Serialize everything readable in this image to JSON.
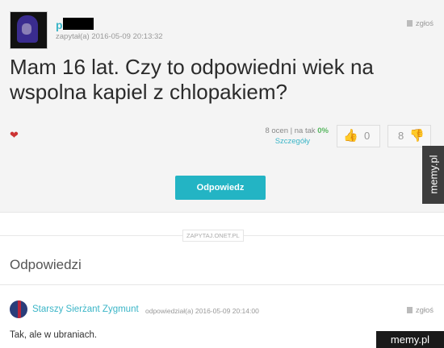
{
  "question": {
    "username": "p       ta",
    "asked_label": "zapytał(a) 2016-05-09 20:13:32",
    "report_label": "zgłoś",
    "title": "Mam 16 lat. Czy to odpowiedni wiek na wspolna kapiel z chlopakiem?",
    "votes_text": "8 ocen | na tak ",
    "votes_pct": "0%",
    "details_label": "Szczegóły",
    "up_count": "0",
    "down_count": "8",
    "answer_button": "Odpowiedz"
  },
  "divider_label": "ZAPYTAJ.ONET.PL",
  "answers": {
    "heading": "Odpowiedzi",
    "items": [
      {
        "author": "Starszy Sierżant Zygmunt",
        "meta": "odpowiedział(a) 2016-05-09 20:14:00",
        "report_label": "zgłoś",
        "text": "Tak, ale w ubraniach."
      }
    ]
  },
  "watermarks": {
    "side": "memy.pl",
    "corner": "memy.pl"
  },
  "colors": {
    "accent": "#23b4c4",
    "link": "#3ab5c7",
    "positive": "#57b65f"
  }
}
